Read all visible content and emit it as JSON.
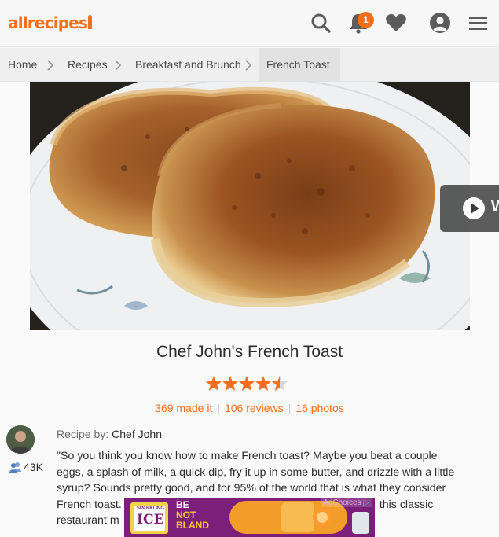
{
  "header": {
    "logo_text": "allrecipes",
    "notification_count": "1",
    "icons": [
      "search-icon",
      "bell-icon",
      "heart-icon",
      "profile-icon",
      "menu-icon"
    ],
    "brand_color": "#f56e1b"
  },
  "breadcrumb": {
    "items": [
      "Home",
      "Recipes",
      "Breakfast and Brunch",
      "French Toast"
    ]
  },
  "video_button": {
    "label_partial": "W"
  },
  "recipe": {
    "title": "Chef John's French Toast",
    "rating": 4.5,
    "rating_max": 5,
    "made_it": "369 made it",
    "reviews": "106 reviews",
    "photos": "16 photos",
    "recipe_by_label": "Recipe by:",
    "author": "Chef John",
    "followers": "43K",
    "description_lines": [
      "\"So you think you know how to make French toast? Maybe you beat a couple",
      "eggs, a splash of milk, a quick dip, fry it up in some butter, and drizzle with a little",
      "syrup? Sounds pretty good, and for 95% of the world that is what they consider",
      "French toast.",
      "this classic",
      "restaurant m"
    ]
  },
  "ad": {
    "choices_label": "AdChoices",
    "brand_small": "SPARKLING",
    "brand": "ICE",
    "slogan_1": "BE",
    "slogan_2": "NOT",
    "slogan_3": "BLAND"
  }
}
